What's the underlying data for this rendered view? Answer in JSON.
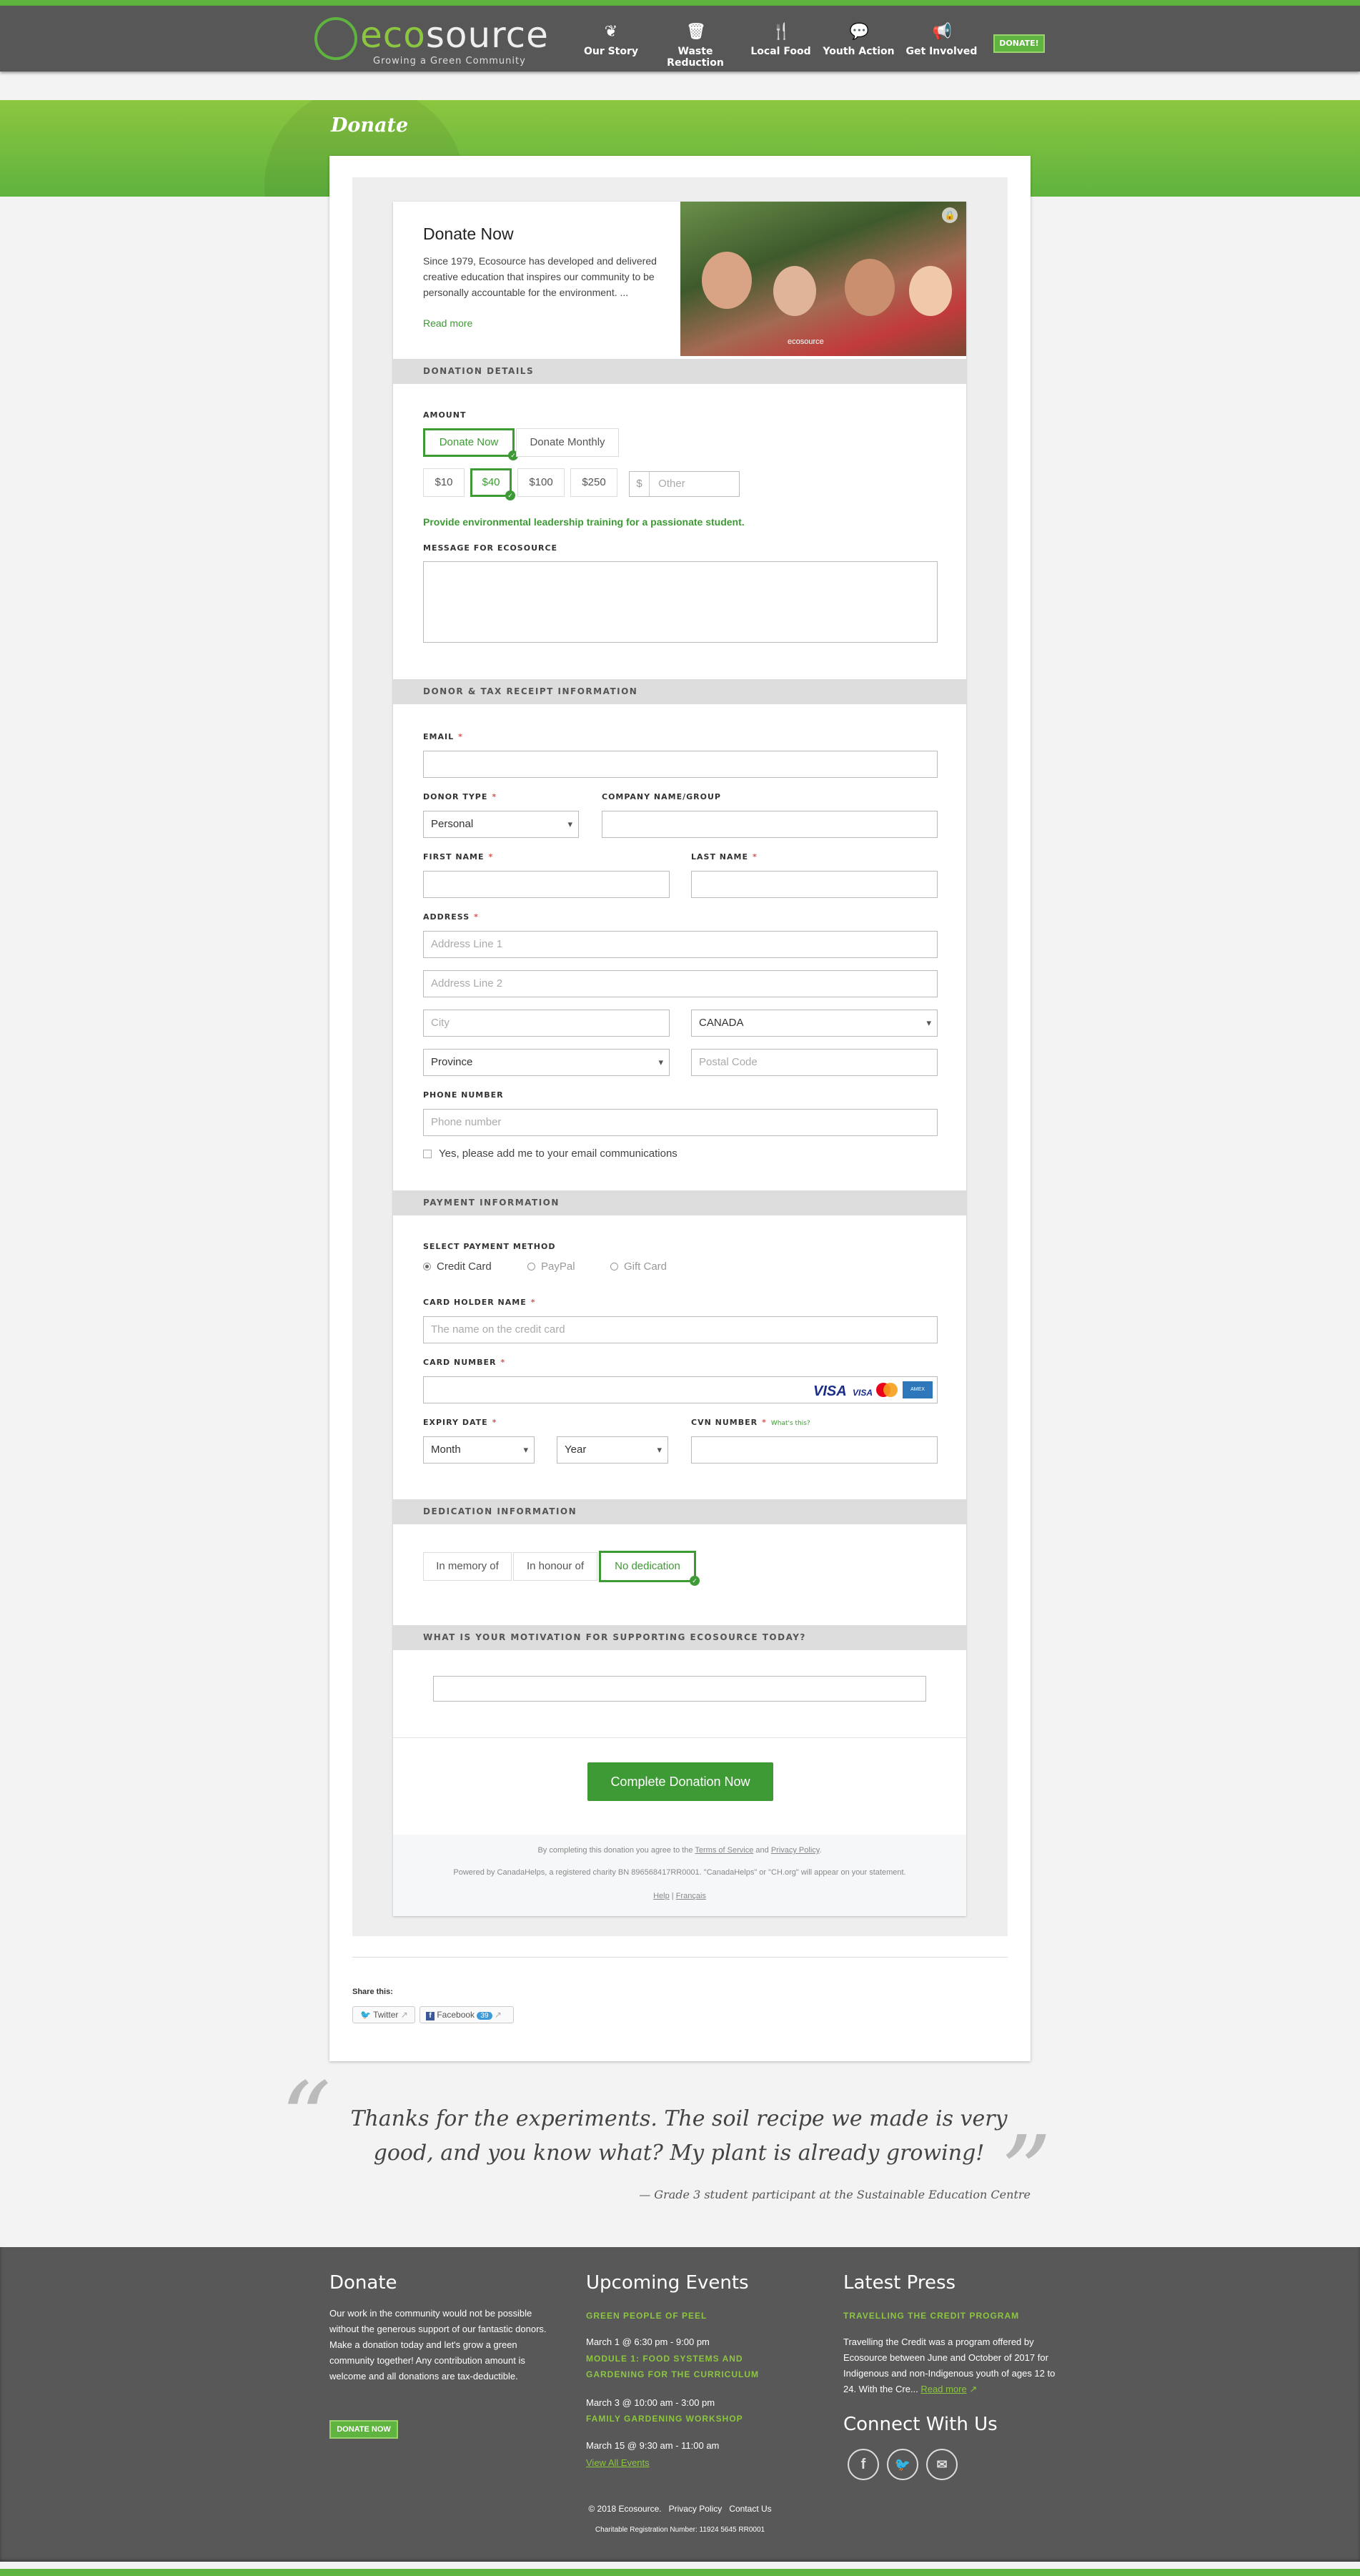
{
  "header": {
    "logo_text_eco": "eco",
    "logo_text_source": "source",
    "logo_tagline": "Growing a Green Community",
    "nav": [
      {
        "label": "Our Story",
        "icon": "leaf-icon"
      },
      {
        "label": "Waste Reduction",
        "icon": "bin-icon"
      },
      {
        "label": "Local Food",
        "icon": "cutlery-icon"
      },
      {
        "label": "Youth Action",
        "icon": "speech-icon"
      },
      {
        "label": "Get Involved",
        "icon": "megaphone-icon"
      }
    ],
    "donate_button": "DONATE!"
  },
  "page": {
    "title": "Donate"
  },
  "intro": {
    "heading": "Donate Now",
    "body": "Since 1979, Ecosource has developed and delivered creative education that inspires our community to be personally accountable for the environment. ...",
    "read_more": "Read more",
    "photo_caption": "ecosource"
  },
  "donation_details": {
    "section_title": "DONATION DETAILS",
    "amount_label": "AMOUNT",
    "frequency": [
      "Donate Now",
      "Donate Monthly"
    ],
    "frequency_selected": "Donate Now",
    "amounts": [
      "$10",
      "$40",
      "$100",
      "$250"
    ],
    "amount_selected": "$40",
    "currency_symbol": "$",
    "other_placeholder": "Other",
    "impact": "Provide environmental leadership training for a passionate student.",
    "message_label": "MESSAGE FOR ECOSOURCE"
  },
  "donor": {
    "section_title": "DONOR & TAX RECEIPT INFORMATION",
    "email_label": "EMAIL",
    "donor_type_label": "DONOR TYPE",
    "donor_type_value": "Personal",
    "company_label": "COMPANY NAME/GROUP",
    "first_name_label": "FIRST NAME",
    "last_name_label": "LAST NAME",
    "address_label": "ADDRESS",
    "address1_placeholder": "Address Line 1",
    "address2_placeholder": "Address Line 2",
    "city_placeholder": "City",
    "country_value": "CANADA",
    "province_value": "Province",
    "postal_placeholder": "Postal Code",
    "phone_label": "PHONE NUMBER",
    "phone_placeholder": "Phone number",
    "optin_label": "Yes, please add me to your email communications",
    "required_mark": "*"
  },
  "payment": {
    "section_title": "PAYMENT INFORMATION",
    "method_label": "SELECT PAYMENT METHOD",
    "methods": [
      "Credit Card",
      "PayPal",
      "Gift Card"
    ],
    "method_selected": "Credit Card",
    "holder_label": "CARD HOLDER NAME",
    "holder_placeholder": "The name on the credit card",
    "card_number_label": "CARD NUMBER",
    "card_brands": [
      "VISA",
      "VISA",
      "",
      ""
    ],
    "expiry_label": "EXPIRY DATE",
    "month_value": "Month",
    "year_value": "Year",
    "cvn_label": "CVN NUMBER",
    "cvn_help": "What's this?"
  },
  "dedication": {
    "section_title": "DEDICATION INFORMATION",
    "options": [
      "In memory of",
      "In honour of",
      "No dedication"
    ],
    "selected": "No dedication"
  },
  "motivation": {
    "section_title": "WHAT IS YOUR MOTIVATION FOR SUPPORTING ECOSOURCE TODAY?"
  },
  "submit": {
    "label": "Complete Donation Now"
  },
  "legal": {
    "agree_prefix": "By completing this donation you agree to the",
    "terms": "Terms of Service",
    "and": "and",
    "privacy": "Privacy Policy",
    "period": ".",
    "powered": "Powered by CanadaHelps, a registered charity BN 896568417RR0001. \"CanadaHelps\" or \"CH.org\" will appear on your statement.",
    "help": "Help",
    "sep": "|",
    "francais": "Français"
  },
  "share": {
    "label": "Share this:",
    "twitter": "Twitter",
    "facebook": "Facebook",
    "facebook_count": "39"
  },
  "quote": {
    "text": "Thanks for the experiments. The soil recipe we made is very good, and you know what? My plant is already growing!",
    "author": "— Grade 3 student participant at the Sustainable Education Centre"
  },
  "footer": {
    "donate": {
      "title": "Donate",
      "body": "Our work in the community would not be possible without the generous support of our fantastic donors. Make a donation today and let's grow a green community together! Any contribution amount is welcome and all donations are tax-deductible.",
      "button": "DONATE NOW"
    },
    "events": {
      "title": "Upcoming Events",
      "items": [
        {
          "name": "GREEN PEOPLE OF PEEL",
          "date": "March 1 @ 6:30 pm - 9:00 pm"
        },
        {
          "name": "MODULE 1: FOOD SYSTEMS AND GARDENING FOR THE CURRICULUM",
          "date": "March 3 @ 10:00 am - 3:00 pm"
        },
        {
          "name": "FAMILY GARDENING WORKSHOP",
          "date": "March 15 @ 9:30 am - 11:00 am"
        }
      ],
      "view_all": "View All Events"
    },
    "press": {
      "title": "Latest Press",
      "headline": "TRAVELLING THE CREDIT PROGRAM",
      "body": "Travelling the Credit was a program offered by Ecosource between June and October of 2017 for Indigenous and non-Indigenous youth of ages 12 to 24. With the Cre...",
      "read_more": "Read more"
    },
    "connect": {
      "title": "Connect With Us",
      "icons": [
        "facebook-icon",
        "twitter-icon",
        "email-icon"
      ]
    },
    "copyright": "© 2018 Ecosource.",
    "privacy": "Privacy Policy",
    "contact": "Contact Us",
    "charity": "Charitable Registration Number: 11924 5645 RR0001"
  },
  "colors": {
    "brand_green": "#5fb33f",
    "light_green": "#8cc63f",
    "dark_green": "#3d9a34",
    "header_gray": "#575757"
  }
}
